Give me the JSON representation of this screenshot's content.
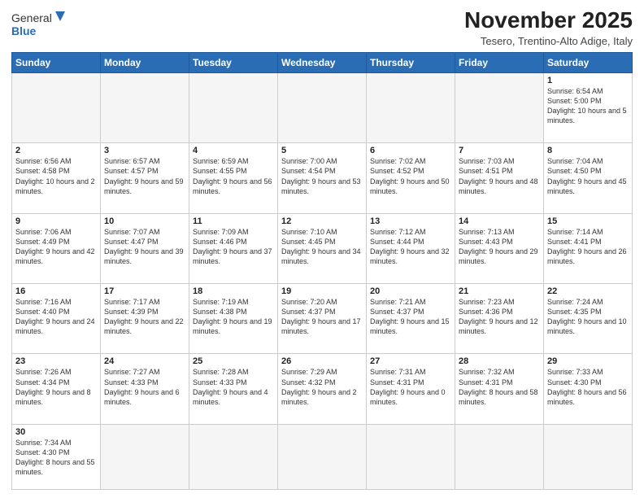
{
  "header": {
    "logo_general": "General",
    "logo_blue": "Blue",
    "month_title": "November 2025",
    "subtitle": "Tesero, Trentino-Alto Adige, Italy"
  },
  "days_of_week": [
    "Sunday",
    "Monday",
    "Tuesday",
    "Wednesday",
    "Thursday",
    "Friday",
    "Saturday"
  ],
  "weeks": [
    [
      {
        "day": "",
        "info": ""
      },
      {
        "day": "",
        "info": ""
      },
      {
        "day": "",
        "info": ""
      },
      {
        "day": "",
        "info": ""
      },
      {
        "day": "",
        "info": ""
      },
      {
        "day": "",
        "info": ""
      },
      {
        "day": "1",
        "info": "Sunrise: 6:54 AM\nSunset: 5:00 PM\nDaylight: 10 hours and 5 minutes."
      }
    ],
    [
      {
        "day": "2",
        "info": "Sunrise: 6:56 AM\nSunset: 4:58 PM\nDaylight: 10 hours and 2 minutes."
      },
      {
        "day": "3",
        "info": "Sunrise: 6:57 AM\nSunset: 4:57 PM\nDaylight: 9 hours and 59 minutes."
      },
      {
        "day": "4",
        "info": "Sunrise: 6:59 AM\nSunset: 4:55 PM\nDaylight: 9 hours and 56 minutes."
      },
      {
        "day": "5",
        "info": "Sunrise: 7:00 AM\nSunset: 4:54 PM\nDaylight: 9 hours and 53 minutes."
      },
      {
        "day": "6",
        "info": "Sunrise: 7:02 AM\nSunset: 4:52 PM\nDaylight: 9 hours and 50 minutes."
      },
      {
        "day": "7",
        "info": "Sunrise: 7:03 AM\nSunset: 4:51 PM\nDaylight: 9 hours and 48 minutes."
      },
      {
        "day": "8",
        "info": "Sunrise: 7:04 AM\nSunset: 4:50 PM\nDaylight: 9 hours and 45 minutes."
      }
    ],
    [
      {
        "day": "9",
        "info": "Sunrise: 7:06 AM\nSunset: 4:49 PM\nDaylight: 9 hours and 42 minutes."
      },
      {
        "day": "10",
        "info": "Sunrise: 7:07 AM\nSunset: 4:47 PM\nDaylight: 9 hours and 39 minutes."
      },
      {
        "day": "11",
        "info": "Sunrise: 7:09 AM\nSunset: 4:46 PM\nDaylight: 9 hours and 37 minutes."
      },
      {
        "day": "12",
        "info": "Sunrise: 7:10 AM\nSunset: 4:45 PM\nDaylight: 9 hours and 34 minutes."
      },
      {
        "day": "13",
        "info": "Sunrise: 7:12 AM\nSunset: 4:44 PM\nDaylight: 9 hours and 32 minutes."
      },
      {
        "day": "14",
        "info": "Sunrise: 7:13 AM\nSunset: 4:43 PM\nDaylight: 9 hours and 29 minutes."
      },
      {
        "day": "15",
        "info": "Sunrise: 7:14 AM\nSunset: 4:41 PM\nDaylight: 9 hours and 26 minutes."
      }
    ],
    [
      {
        "day": "16",
        "info": "Sunrise: 7:16 AM\nSunset: 4:40 PM\nDaylight: 9 hours and 24 minutes."
      },
      {
        "day": "17",
        "info": "Sunrise: 7:17 AM\nSunset: 4:39 PM\nDaylight: 9 hours and 22 minutes."
      },
      {
        "day": "18",
        "info": "Sunrise: 7:19 AM\nSunset: 4:38 PM\nDaylight: 9 hours and 19 minutes."
      },
      {
        "day": "19",
        "info": "Sunrise: 7:20 AM\nSunset: 4:37 PM\nDaylight: 9 hours and 17 minutes."
      },
      {
        "day": "20",
        "info": "Sunrise: 7:21 AM\nSunset: 4:37 PM\nDaylight: 9 hours and 15 minutes."
      },
      {
        "day": "21",
        "info": "Sunrise: 7:23 AM\nSunset: 4:36 PM\nDaylight: 9 hours and 12 minutes."
      },
      {
        "day": "22",
        "info": "Sunrise: 7:24 AM\nSunset: 4:35 PM\nDaylight: 9 hours and 10 minutes."
      }
    ],
    [
      {
        "day": "23",
        "info": "Sunrise: 7:26 AM\nSunset: 4:34 PM\nDaylight: 9 hours and 8 minutes."
      },
      {
        "day": "24",
        "info": "Sunrise: 7:27 AM\nSunset: 4:33 PM\nDaylight: 9 hours and 6 minutes."
      },
      {
        "day": "25",
        "info": "Sunrise: 7:28 AM\nSunset: 4:33 PM\nDaylight: 9 hours and 4 minutes."
      },
      {
        "day": "26",
        "info": "Sunrise: 7:29 AM\nSunset: 4:32 PM\nDaylight: 9 hours and 2 minutes."
      },
      {
        "day": "27",
        "info": "Sunrise: 7:31 AM\nSunset: 4:31 PM\nDaylight: 9 hours and 0 minutes."
      },
      {
        "day": "28",
        "info": "Sunrise: 7:32 AM\nSunset: 4:31 PM\nDaylight: 8 hours and 58 minutes."
      },
      {
        "day": "29",
        "info": "Sunrise: 7:33 AM\nSunset: 4:30 PM\nDaylight: 8 hours and 56 minutes."
      }
    ],
    [
      {
        "day": "30",
        "info": "Sunrise: 7:34 AM\nSunset: 4:30 PM\nDaylight: 8 hours and 55 minutes."
      },
      {
        "day": "",
        "info": ""
      },
      {
        "day": "",
        "info": ""
      },
      {
        "day": "",
        "info": ""
      },
      {
        "day": "",
        "info": ""
      },
      {
        "day": "",
        "info": ""
      },
      {
        "day": "",
        "info": ""
      }
    ]
  ]
}
